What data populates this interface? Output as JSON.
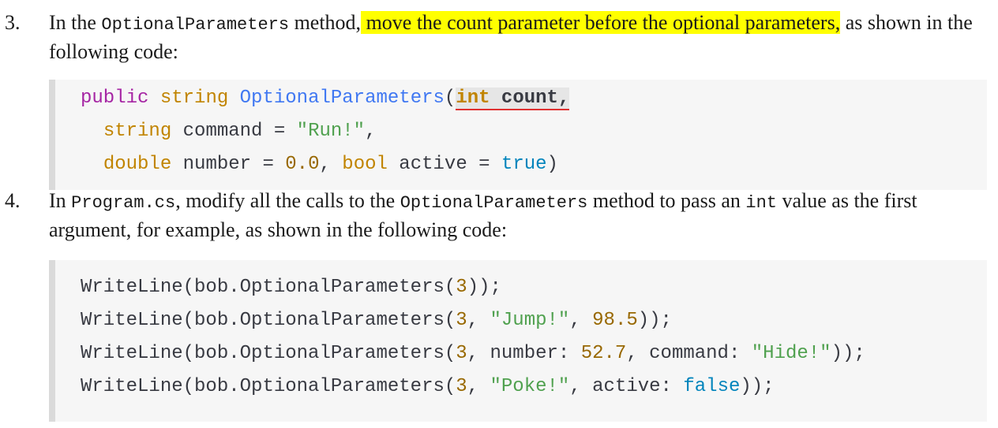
{
  "step3": {
    "number": "3.",
    "text_before": "In the ",
    "code_method": "OptionalParameters",
    "text_mid": " method,",
    "highlight": " move the count parameter before the optional parameters,",
    "text_after": " as shown in the following code:",
    "code": {
      "l1_kw": "public",
      "l1_type": "string",
      "l1_fn": "OptionalParameters",
      "l1_paren": "(",
      "l1_sel_type": "int",
      "l1_sel_name": " count,",
      "l2_type": "string",
      "l2_rest": " command = ",
      "l2_str": "\"Run!\"",
      "l2_end": ",",
      "l3_type1": "double",
      "l3_mid1": " number = ",
      "l3_num": "0.0",
      "l3_mid2": ", ",
      "l3_type2": "bool",
      "l3_mid3": " active = ",
      "l3_bool": "true",
      "l3_end": ")"
    }
  },
  "step4": {
    "number": "4.",
    "text_before": "In ",
    "code_file": "Program.cs",
    "text_mid1": ", modify all the calls to the ",
    "code_method": "OptionalParameters",
    "text_mid2": " method to pass an ",
    "code_int": "int",
    "text_after": " value as the first argument, for example, as shown in the following code:",
    "code": {
      "prefix": "WriteLine(bob.OptionalParameters(",
      "l1_num": "3",
      "l1_end": "));",
      "l2_num": "3",
      "l2_mid1": ", ",
      "l2_str": "\"Jump!\"",
      "l2_mid2": ", ",
      "l2_num2": "98.5",
      "l2_end": "));",
      "l3_num": "3",
      "l3_mid1": ", number: ",
      "l3_num2": "52.7",
      "l3_mid2": ", command: ",
      "l3_str": "\"Hide!\"",
      "l3_end": "));",
      "l4_num": "3",
      "l4_mid1": ", ",
      "l4_str": "\"Poke!\"",
      "l4_mid2": ", active: ",
      "l4_bool": "false",
      "l4_end": "));"
    }
  }
}
